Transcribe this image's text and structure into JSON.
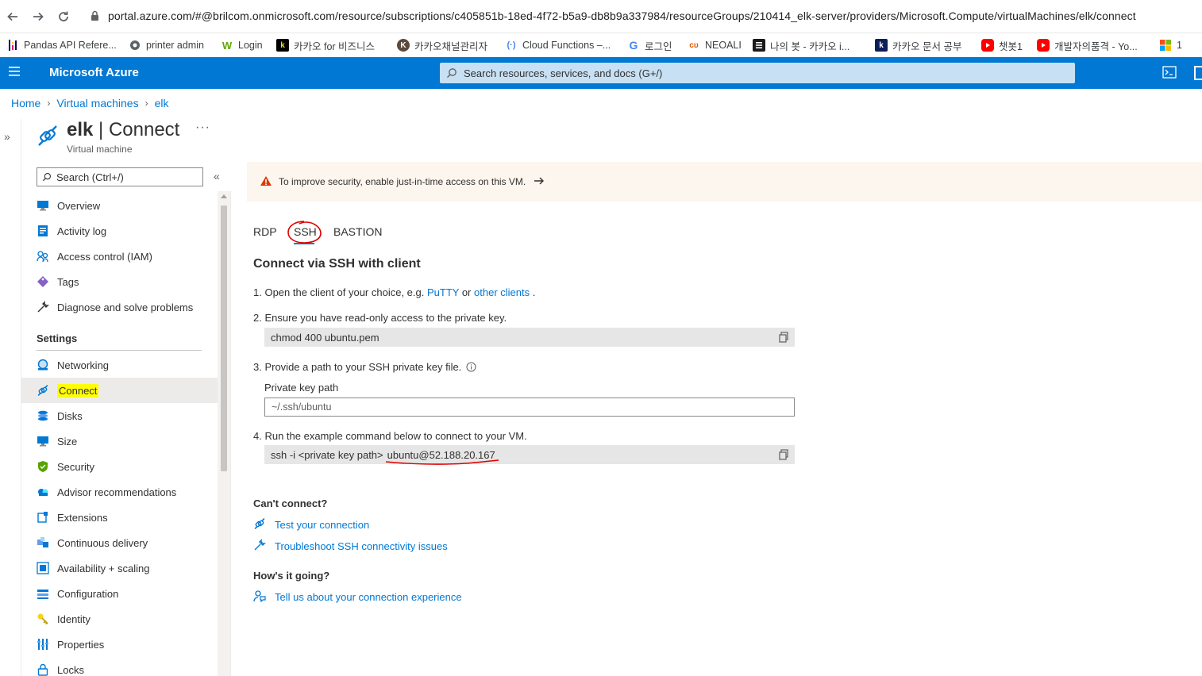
{
  "browser": {
    "url": "portal.azure.com/#@brilcom.onmicrosoft.com/resource/subscriptions/c405851b-18ed-4f72-b5a9-db8b9a337984/resourceGroups/210414_elk-server/providers/Microsoft.Compute/virtualMachines/elk/connect",
    "bookmarks": [
      {
        "label": "Pandas API Refere...",
        "icon": "pandas-icon"
      },
      {
        "label": "printer admin",
        "icon": "globe-icon"
      },
      {
        "label": "Login",
        "icon": "w-logo-icon"
      },
      {
        "label": "카카오 for 비즈니스",
        "icon": "k-logo-icon"
      },
      {
        "label": "카카오채널관리자",
        "icon": "kakao-icon"
      },
      {
        "label": "Cloud Functions –...",
        "icon": "cloud-functions-icon"
      },
      {
        "label": "로그인",
        "icon": "google-icon"
      },
      {
        "label": "NEOALI",
        "icon": "neoali-icon"
      },
      {
        "label": "나의 봇 - 카카오 i...",
        "icon": "bot-icon"
      },
      {
        "label": "카카오 문서 공부",
        "icon": "k-logo-icon"
      },
      {
        "label": "챗봇1",
        "icon": "youtube-icon"
      },
      {
        "label": "개발자의품격 - Yo...",
        "icon": "youtube-icon"
      },
      {
        "label": "1",
        "icon": "microsoft-icon"
      }
    ]
  },
  "azure": {
    "brand": "Microsoft Azure",
    "search_placeholder": "Search resources, services, and docs (G+/)"
  },
  "breadcrumb": [
    "Home",
    "Virtual machines",
    "elk"
  ],
  "resource": {
    "name": "elk",
    "separator": "|",
    "blade": "Connect",
    "type": "Virtual machine"
  },
  "menu": {
    "search_placeholder": "Search (Ctrl+/)",
    "top_items": [
      "Overview",
      "Activity log",
      "Access control (IAM)",
      "Tags",
      "Diagnose and solve problems"
    ],
    "settings_header": "Settings",
    "settings_items": [
      "Networking",
      "Connect",
      "Disks",
      "Size",
      "Security",
      "Advisor recommendations",
      "Extensions",
      "Continuous delivery",
      "Availability + scaling",
      "Configuration",
      "Identity",
      "Properties",
      "Locks"
    ],
    "active": "Connect"
  },
  "banner": {
    "text": "To improve security, enable just-in-time access on this VM."
  },
  "tabs": [
    "RDP",
    "SSH",
    "BASTION"
  ],
  "active_tab": "SSH",
  "content": {
    "title": "Connect via SSH with client",
    "step1_prefix": "1. Open the client of your choice, e.g.",
    "step1_link1": "PuTTY",
    "step1_mid": "or",
    "step1_link2": "other clients",
    "step1_suffix": ".",
    "step2": "2. Ensure you have read-only access to the private key.",
    "step2_code": "chmod 400 ubuntu.pem",
    "step3": "3. Provide a path to your SSH private key file.",
    "pk_label": "Private key path",
    "pk_placeholder": "~/.ssh/ubuntu",
    "step4": "4. Run the example command below to connect to your VM.",
    "step4_code_prefix": "ssh -i <private key path>",
    "step4_code_host": "ubuntu@52.188.20.167",
    "cant_connect": "Can't connect?",
    "link_test": "Test your connection",
    "link_troubleshoot": "Troubleshoot SSH connectivity issues",
    "hows_it_going": "How's it going?",
    "link_feedback": "Tell us about your connection experience"
  },
  "colors": {
    "azure_blue": "#0078d4",
    "search_bg": "#c7e0f4",
    "banner_bg": "#fdf6ee",
    "highlight": "#ffff00",
    "annotation_red": "#e00000"
  }
}
